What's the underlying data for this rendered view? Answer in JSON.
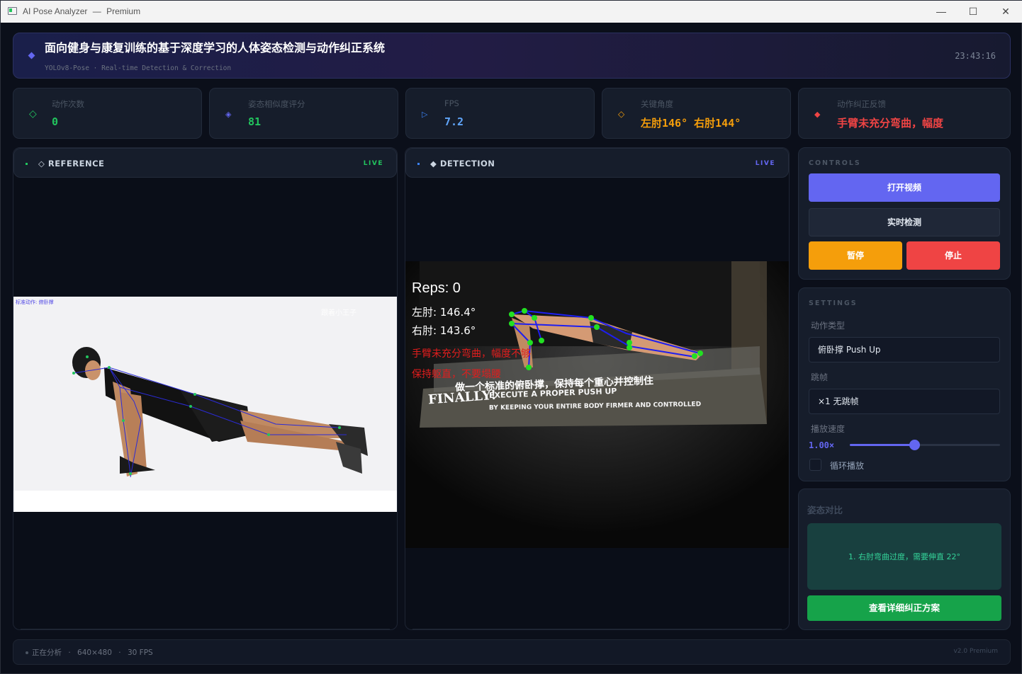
{
  "window": {
    "app_name": "AI Pose Analyzer",
    "separator": "—",
    "edition": "Premium"
  },
  "header": {
    "title": "面向健身与康复训练的基于深度学习的人体姿态检测与动作纠正系统",
    "subtitle": "YOLOv8-Pose · Real-time Detection & Correction",
    "clock": "23:43:16"
  },
  "stats": [
    {
      "label": "动作次数",
      "value": "0",
      "icon": "diamond-outline-icon",
      "color": "#22c55e"
    },
    {
      "label": "姿态相似度评分",
      "value": "81",
      "icon": "diamond-target-icon",
      "color": "#22c55e"
    },
    {
      "label": "FPS",
      "value": "7.2",
      "icon": "play-triangle-icon",
      "color": "#60a5fa"
    },
    {
      "label": "关键角度",
      "value": "左肘146° 右肘144°",
      "icon": "diamond-outline-icon",
      "color": "#f59e0b"
    },
    {
      "label": "动作纠正反馈",
      "value": "手臂未充分弯曲，幅度",
      "icon": "diamond-filled-icon",
      "color": "#ef4444"
    }
  ],
  "reference_panel": {
    "title": "◇ REFERENCE",
    "live": "LIVE",
    "video_caption": "标准动作: 俯卧撑",
    "watermark": "跟着小王子"
  },
  "detection_panel": {
    "title": "◆ DETECTION",
    "live": "LIVE",
    "overlay": {
      "reps": "Reps: 0",
      "left_elbow": "左肘: 146.4°",
      "right_elbow": "右肘: 143.6°",
      "feedback_1": "手臂未充分弯曲，幅度不够",
      "feedback_2": "保持躯直，不要塌腰"
    },
    "scene_text": {
      "finally": "FINALLY!",
      "line1": "EXECUTE A PROPER PUSH UP",
      "line2": "BY KEEPING YOUR ENTIRE BODY FIRMER AND CONTROLLED",
      "cn_line": "做一个标准的俯卧撑，保持每个重心并控制住"
    }
  },
  "controls": {
    "section": "CONTROLS",
    "open_video": "打开视频",
    "realtime": "实时检测",
    "pause": "暂停",
    "stop": "停止"
  },
  "settings": {
    "section": "SETTINGS",
    "action_type_label": "动作类型",
    "action_type_value": "俯卧撑 Push Up",
    "frame_skip_label": "跳帧",
    "frame_skip_value": "×1 无跳帧",
    "speed_label": "播放速度",
    "speed_value": "1.00×",
    "speed_fraction": 0.43,
    "loop_label": "循环播放",
    "loop_checked": false
  },
  "compare": {
    "section": "姿态对比",
    "message": "1. 右肘弯曲过度，需要伸直 22°",
    "button": "查看详细纠正方案"
  },
  "status": {
    "state": "正在分析",
    "resolution": "640×480",
    "fps": "30 FPS",
    "version": "v2.0 Premium"
  }
}
